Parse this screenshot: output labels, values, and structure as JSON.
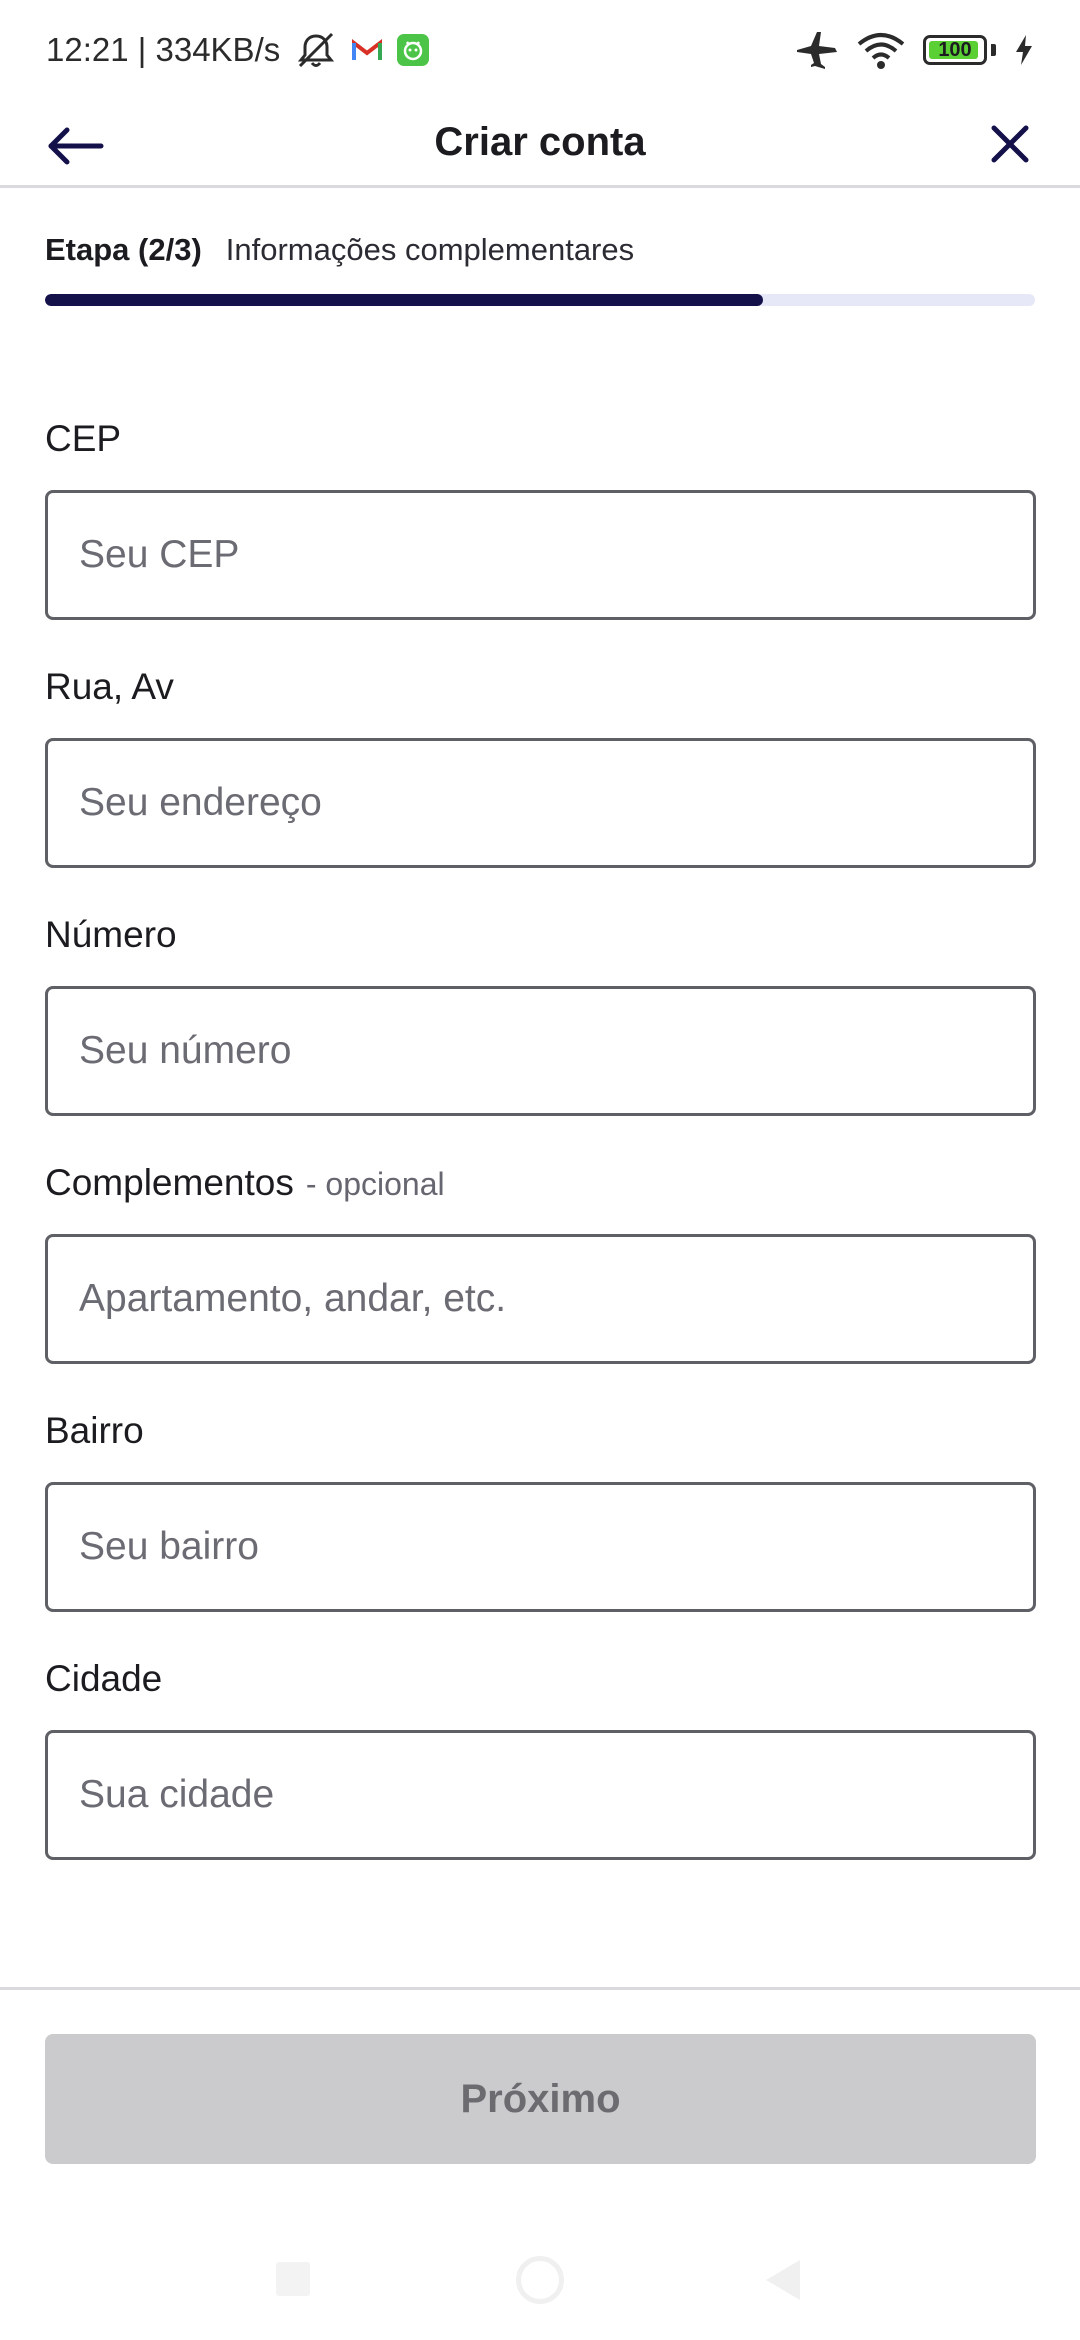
{
  "status_bar": {
    "time_speed": "12:21 | 334KB/s",
    "battery_level": "100",
    "battery_fraction": 0.95,
    "icons": [
      "mute-icon",
      "gmail-icon",
      "app-notification-icon",
      "airplane-icon",
      "wifi-icon",
      "battery-icon",
      "charging-icon"
    ]
  },
  "app_bar": {
    "title": "Criar conta",
    "back_icon": "arrow-left-icon",
    "close_icon": "close-icon"
  },
  "step": {
    "count": "Etapa (2/3)",
    "description": "Informações complementares",
    "progress": 0.725
  },
  "form": {
    "cep": {
      "label": "CEP",
      "placeholder": "Seu CEP",
      "value": ""
    },
    "street": {
      "label": "Rua, Av",
      "placeholder": "Seu endereço",
      "value": ""
    },
    "number": {
      "label": "Número",
      "placeholder": "Seu número",
      "value": ""
    },
    "complement": {
      "label": "Complementos",
      "optional": "- opcional",
      "placeholder": "Apartamento, andar, etc.",
      "value": ""
    },
    "district": {
      "label": "Bairro",
      "placeholder": "Seu bairro",
      "value": ""
    },
    "city": {
      "label": "Cidade",
      "placeholder": "Sua cidade",
      "value": ""
    }
  },
  "footer": {
    "next_label": "Próximo",
    "next_enabled": false
  },
  "colors": {
    "primary": "#14114a",
    "progress_track": "#e6e7f7",
    "button_disabled_bg": "#cbcbcd",
    "button_disabled_text": "#6c6c70",
    "input_border": "#5f5f66",
    "battery_green": "#5bd034"
  }
}
